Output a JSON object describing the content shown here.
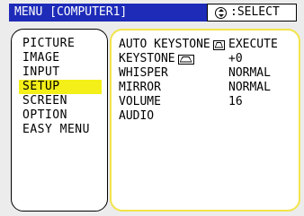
{
  "header": {
    "title": "MENU [COMPUTER1]",
    "hint": ":SELECT",
    "hint_icon": "select-dial-icon"
  },
  "menu": {
    "items": [
      {
        "label": "PICTURE"
      },
      {
        "label": "IMAGE"
      },
      {
        "label": "INPUT"
      },
      {
        "label": "SETUP",
        "selected": true
      },
      {
        "label": "SCREEN"
      },
      {
        "label": "OPTION"
      },
      {
        "label": "EASY MENU"
      }
    ]
  },
  "settings": {
    "rows": [
      {
        "label": "AUTO KEYSTONE",
        "icon": "keystone-icon",
        "value": "EXECUTE"
      },
      {
        "label": "KEYSTONE",
        "icon": "keystone-icon",
        "value": "+0"
      },
      {
        "label": "WHISPER",
        "value": "NORMAL"
      },
      {
        "label": "MIRROR",
        "value": "NORMAL"
      },
      {
        "label": "VOLUME",
        "value": "16"
      },
      {
        "label": "AUDIO",
        "value": ""
      }
    ]
  },
  "colors": {
    "header_bg": "#1d2bb8",
    "selection": "#f4ef18",
    "panel_border_active": "#f2e44a"
  }
}
